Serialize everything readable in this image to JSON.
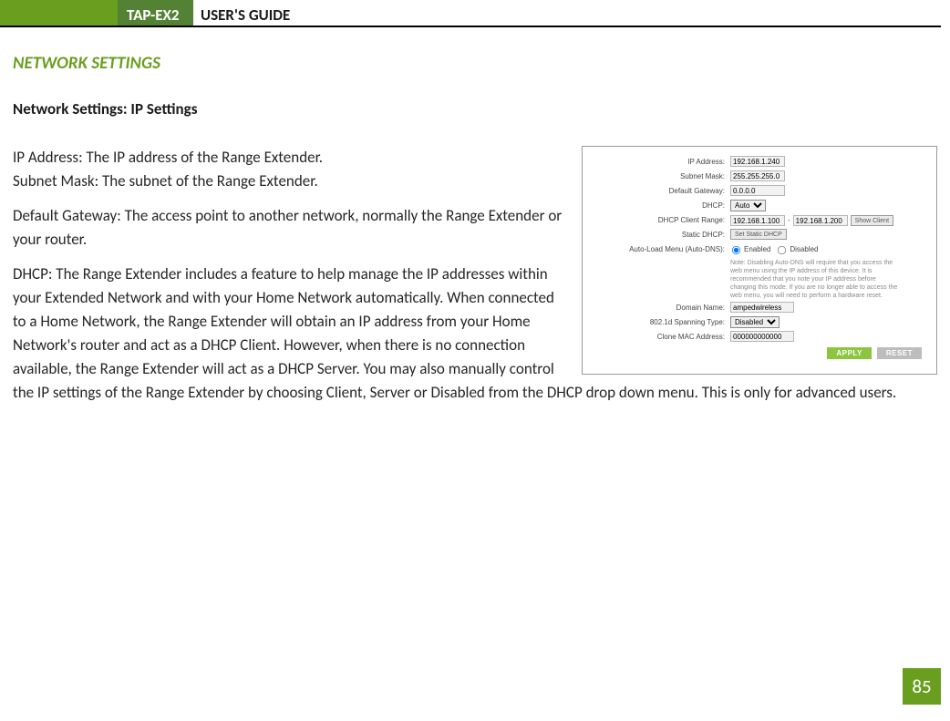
{
  "header": {
    "model": "TAP-EX2",
    "title": "USER'S GUIDE"
  },
  "section_title": "NETWORK SETTINGS",
  "subhead": "Network Settings: IP Settings",
  "paragraphs": {
    "p1": "IP Address: The IP address of the Range Extender.",
    "p2": "Subnet Mask: The subnet of the Range Extender.",
    "p3": "Default Gateway: The access point to another network, normally the Range Extender or your router.",
    "p4": "DHCP: The Range Extender includes a feature to help manage the IP addresses within your Extended Network and with your Home Network automatically. When connected to a Home Network, the Range Extender will obtain an IP address from your Home Network's router and act as a DHCP Client. However, when there is no connection available, the Range Extender will act as a DHCP Server. You may also manually control the IP settings of the Range Extender by choosing Client, Server or Disabled from the DHCP drop down menu. This is only for advanced users."
  },
  "figure": {
    "labels": {
      "ip": "IP Address:",
      "subnet": "Subnet Mask:",
      "gateway": "Default Gateway:",
      "dhcp": "DHCP:",
      "range": "DHCP Client Range:",
      "static": "Static DHCP:",
      "autodns": "Auto-Load Menu (Auto-DNS):",
      "domain": "Domain Name:",
      "spanning": "802.1d Spanning Type:",
      "mac": "Clone MAC Address:"
    },
    "values": {
      "ip": "192.168.1.240",
      "subnet": "255.255.255.0",
      "gateway": "0.0.0.0",
      "dhcp": "Auto",
      "range_from": "192.168.1.100",
      "range_to": "192.168.1.200",
      "show_client": "Show Client",
      "static_btn": "Set Static DHCP",
      "enabled": "Enabled",
      "disabled": "Disabled",
      "note": "Note: Disabling Auto-DNS will require that you access the web menu using the IP address of this device. It is recommended that you note your IP address before changing this mode. If you are no longer able to access the web menu, you will need to perform a hardware reset.",
      "domain": "ampedwireless",
      "spanning": "Disabled",
      "mac": "000000000000"
    },
    "buttons": {
      "apply": "APPLY",
      "reset": "RESET"
    }
  },
  "page_number": "85"
}
